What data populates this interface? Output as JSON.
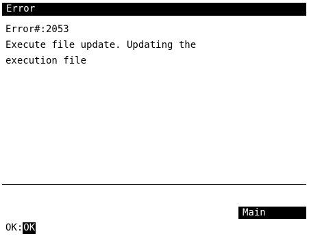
{
  "window": {
    "title": "Error"
  },
  "message": {
    "error_code_line": "Error#:2053",
    "detail_line_1": "Execute file update. Updating the",
    "detail_line_2": "execution file"
  },
  "softkeys": {
    "main_label": "Main"
  },
  "footer": {
    "hint_key": "OK:",
    "hint_action": "OK"
  },
  "colors": {
    "background": "#ffffff",
    "foreground": "#000000",
    "inverse_background": "#000000",
    "inverse_foreground": "#ffffff"
  }
}
